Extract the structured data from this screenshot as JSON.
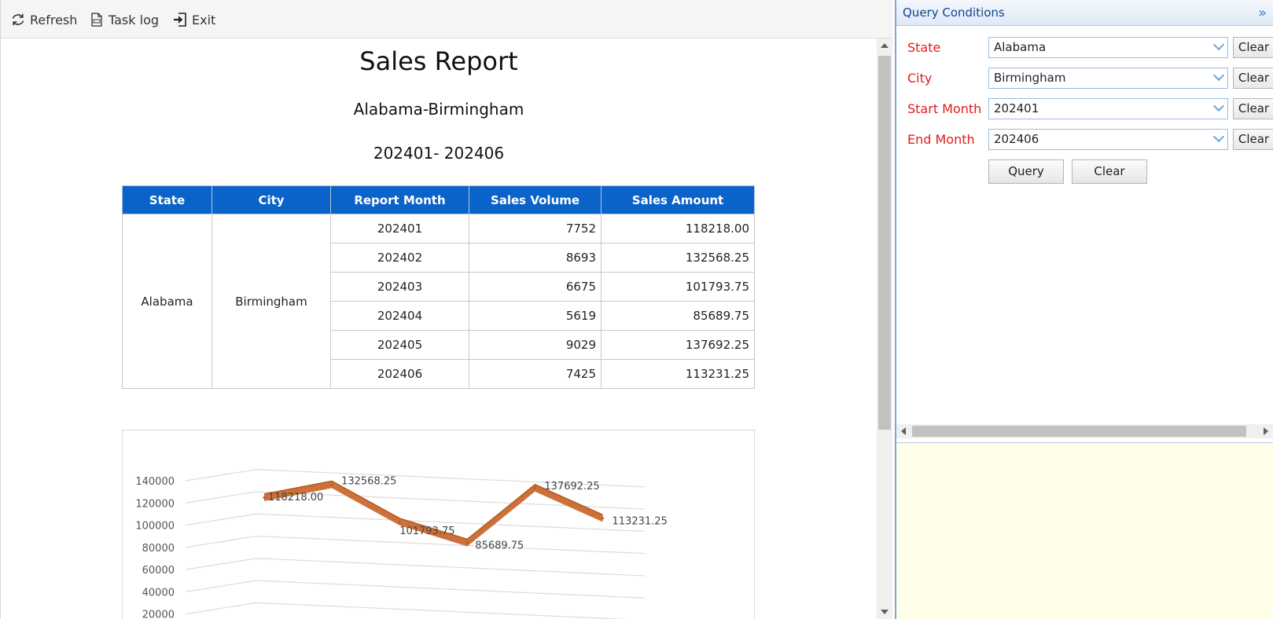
{
  "toolbar": {
    "refresh_label": "Refresh",
    "tasklog_label": "Task log",
    "exit_label": "Exit"
  },
  "report": {
    "title": "Sales Report",
    "subtitle": "Alabama-Birmingham",
    "range": "202401- 202406",
    "table": {
      "headers": [
        "State",
        "City",
        "Report Month",
        "Sales Volume",
        "Sales Amount"
      ],
      "state": "Alabama",
      "city": "Birmingham",
      "rows": [
        {
          "month": "202401",
          "volume": "7752",
          "amount": "118218.00"
        },
        {
          "month": "202402",
          "volume": "8693",
          "amount": "132568.25"
        },
        {
          "month": "202403",
          "volume": "6675",
          "amount": "101793.75"
        },
        {
          "month": "202404",
          "volume": "5619",
          "amount": "85689.75"
        },
        {
          "month": "202405",
          "volume": "9029",
          "amount": "137692.25"
        },
        {
          "month": "202406",
          "volume": "7425",
          "amount": "113231.25"
        }
      ]
    }
  },
  "chart_data": {
    "type": "line",
    "title": "",
    "xlabel": "",
    "ylabel": "",
    "ylim": [
      0,
      140000
    ],
    "yticks": [
      "140000",
      "120000",
      "100000",
      "80000",
      "60000",
      "40000",
      "20000"
    ],
    "series": [
      {
        "values": [
          118218.0,
          132568.25,
          101793.75,
          85689.75,
          137692.25,
          113231.25
        ]
      }
    ],
    "data_labels": [
      "118218.00",
      "132568.25",
      "101793.75",
      "85689.75",
      "137692.25",
      "113231.25"
    ],
    "grid": true,
    "series_color": "#c8692e"
  },
  "query": {
    "title": "Query Conditions",
    "fields": [
      {
        "label": "State",
        "value": "Alabama",
        "clear": "Clear"
      },
      {
        "label": "City",
        "value": "Birmingham",
        "clear": "Clear"
      },
      {
        "label": "Start Month",
        "value": "202401",
        "clear": "Clear"
      },
      {
        "label": "End Month",
        "value": "202406",
        "clear": "Clear"
      }
    ],
    "query_button": "Query",
    "clear_button": "Clear"
  },
  "colors": {
    "header_blue": "#0a63c9",
    "label_red": "#e31b1b",
    "lower_panel": "#fffee8"
  }
}
